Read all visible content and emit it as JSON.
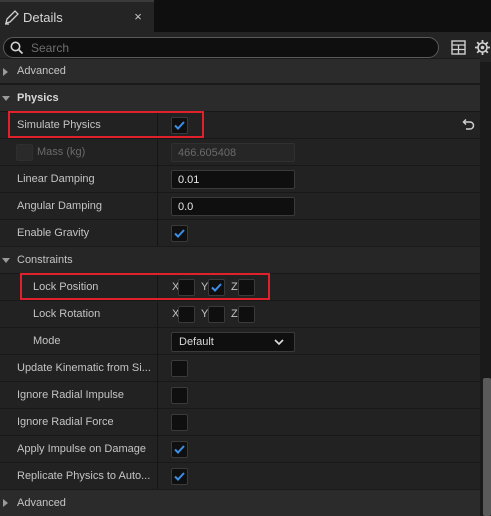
{
  "tab": {
    "title": "Details",
    "close": "×",
    "icon": "pencil-icon"
  },
  "search": {
    "placeholder": "Search",
    "value": ""
  },
  "toolbar": {
    "grid_icon": "table-view-icon",
    "settings_icon": "gear-icon"
  },
  "rows": {
    "advanced_top": "Advanced",
    "physics": "Physics",
    "simulate_physics": {
      "label": "Simulate Physics",
      "checked": true
    },
    "mass": {
      "label": "Mass (kg)",
      "value": "466.605408",
      "enabled": false
    },
    "linear_damping": {
      "label": "Linear Damping",
      "value": "0.01"
    },
    "angular_damping": {
      "label": "Angular Damping",
      "value": "0.0"
    },
    "enable_gravity": {
      "label": "Enable Gravity",
      "checked": true
    },
    "constraints": "Constraints",
    "lock_position": {
      "label": "Lock Position",
      "x": false,
      "y": true,
      "z": false
    },
    "lock_rotation": {
      "label": "Lock Rotation",
      "x": false,
      "y": false,
      "z": false
    },
    "mode": {
      "label": "Mode",
      "value": "Default"
    },
    "update_kinematic": {
      "label": "Update Kinematic from Si...",
      "checked": false
    },
    "ignore_radial_impulse": {
      "label": "Ignore Radial Impulse",
      "checked": false
    },
    "ignore_radial_force": {
      "label": "Ignore Radial Force",
      "checked": false
    },
    "apply_impulse": {
      "label": "Apply Impulse on Damage",
      "checked": true
    },
    "replicate_physics": {
      "label": "Replicate Physics to Auto...",
      "checked": true
    },
    "advanced_bottom": "Advanced"
  },
  "axes": {
    "x": "X",
    "y": "Y",
    "z": "Z"
  },
  "colors": {
    "check": "#3d8ee6",
    "highlight": "#e0202a",
    "background": "#1a1a1a"
  }
}
